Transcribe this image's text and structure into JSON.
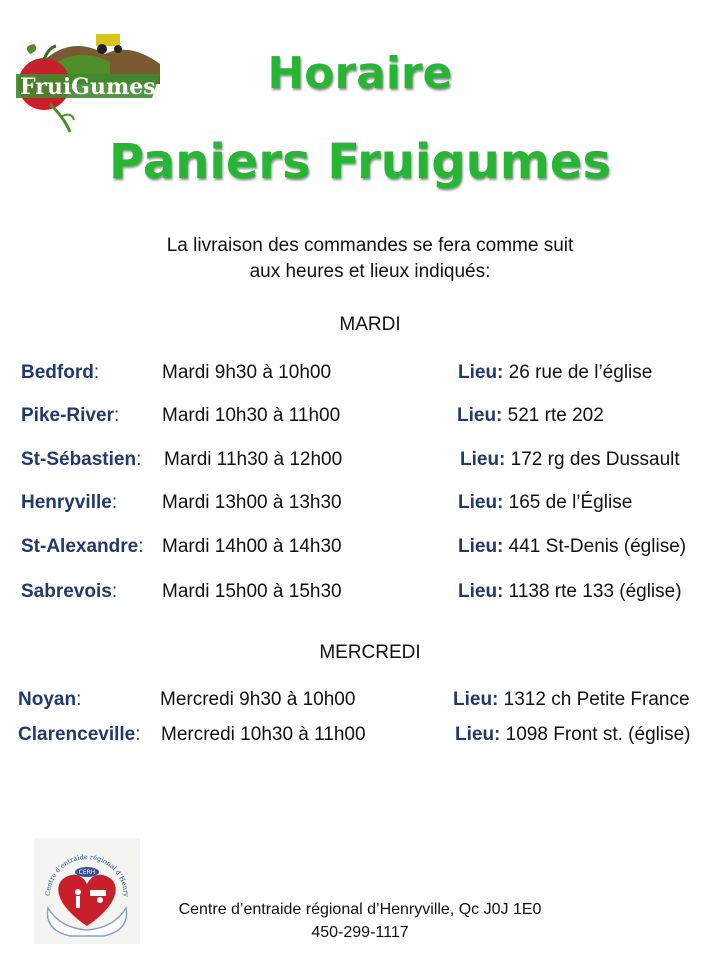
{
  "logo_top": {
    "text": "FruiGumes",
    "icon": "fruigumes-logo"
  },
  "title_line1": "Horaire",
  "title_line2": "Paniers Fruigumes",
  "intro_line1": "La livraison des commandes se fera comme suit",
  "intro_line2": "aux heures et lieux indiqués:",
  "tuesday": {
    "heading": "MARDI",
    "rows": [
      {
        "city": "Bedford",
        "time": "Mardi 9h30 à 10h00",
        "lieu_label": "Lieu:",
        "address": "26 rue de l’église"
      },
      {
        "city": "Pike-River",
        "time": "Mardi 10h30 à 11h00",
        "lieu_label": "Lieu:",
        "address": "521 rte 202"
      },
      {
        "city": "St-Sébastien",
        "time": "Mardi 11h30 à 12h00",
        "lieu_label": "Lieu:",
        "address": "172 rg des Dussault"
      },
      {
        "city": "Henryville",
        "time": "Mardi 13h00 à 13h30",
        "lieu_label": "Lieu:",
        "address": "165 de l’Église"
      },
      {
        "city": "St-Alexandre",
        "time": "Mardi 14h00 à 14h30",
        "lieu_label": "Lieu:",
        "address": "441 St-Denis (église)"
      },
      {
        "city": "Sabrevois",
        "time": "Mardi 15h00 à 15h30",
        "lieu_label": "Lieu:",
        "address": "1138 rte 133 (église)"
      }
    ]
  },
  "wednesday": {
    "heading": "MERCREDI",
    "rows": [
      {
        "city": "Noyan",
        "time": "Mercredi 9h30 à 10h00",
        "lieu_label": "Lieu:",
        "address": "1312 ch Petite France"
      },
      {
        "city": "Clarenceville",
        "time": "Mercredi 10h30 à 11h00",
        "lieu_label": "Lieu:",
        "address": "1098 Front st. (église)"
      }
    ]
  },
  "logo_bottom": {
    "text": "Centre d’entraide régional d’Henryville",
    "badge": "CERH",
    "icon": "cerh-heart-logo"
  },
  "footer_line1": "Centre d’entraide régional d’Henryville, Qc  J0J 1E0",
  "footer_line2": "450-299-1117"
}
